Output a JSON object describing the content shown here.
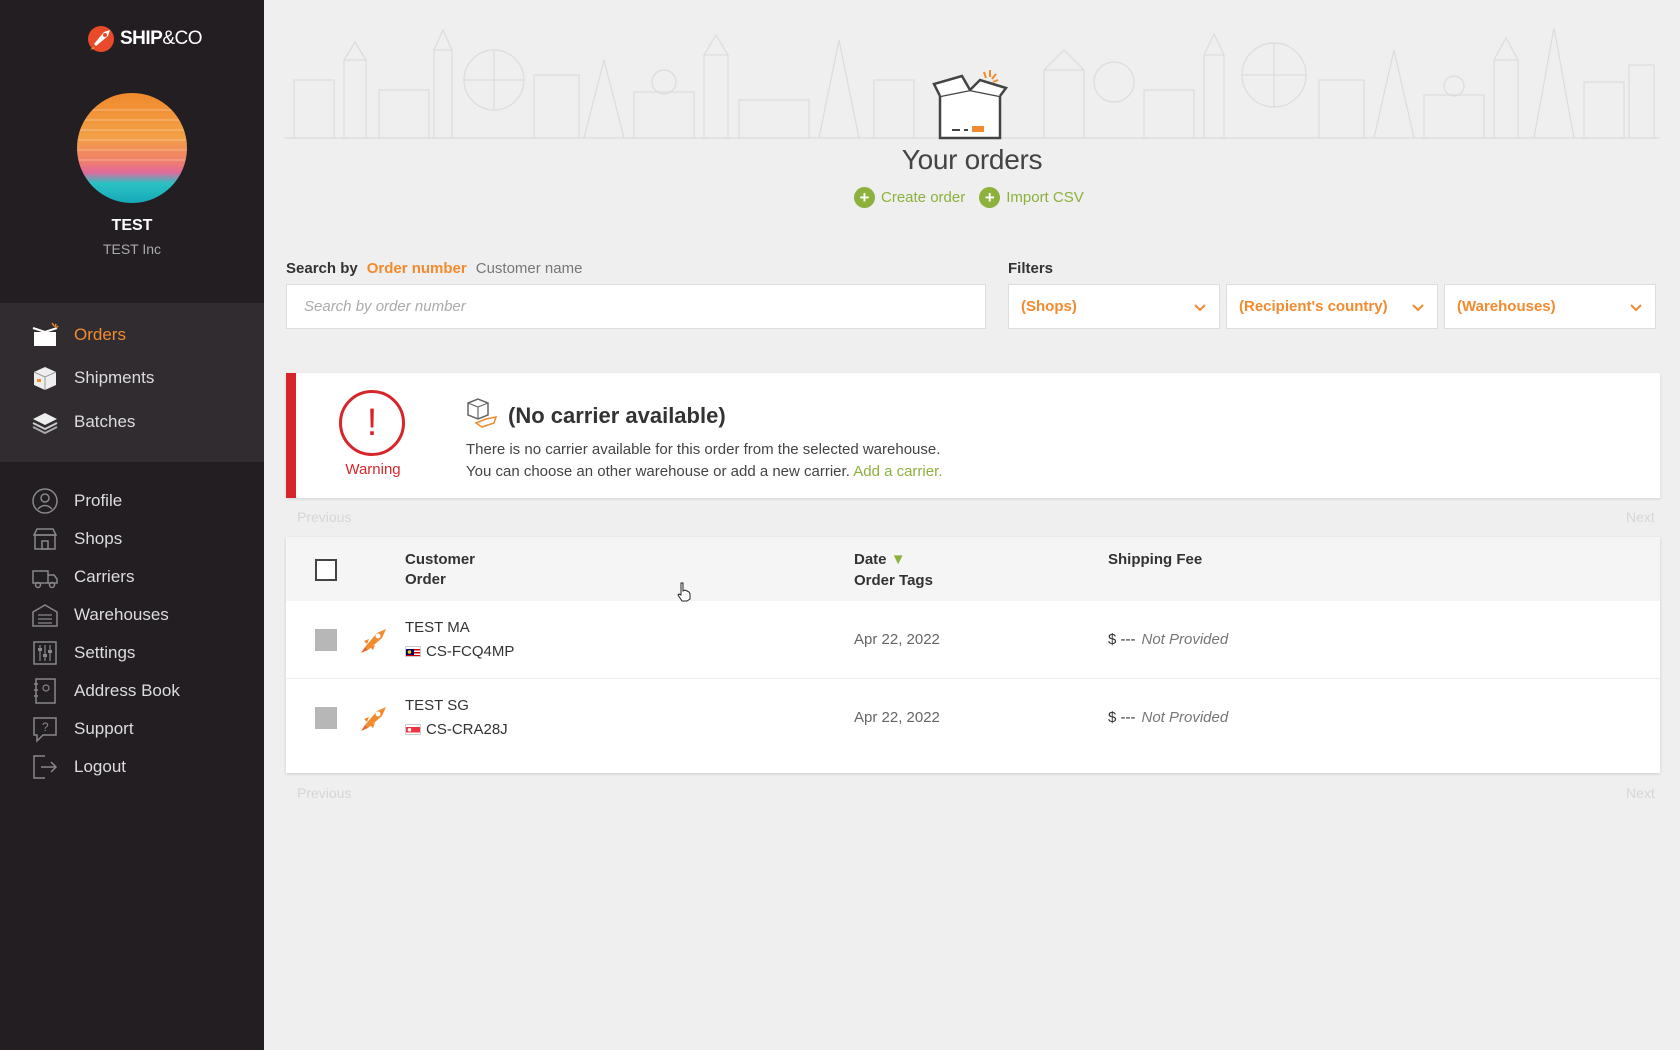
{
  "brand": {
    "name_bold": "SHIP",
    "name_rest": "&CO"
  },
  "user": {
    "name": "TEST",
    "company": "TEST Inc"
  },
  "nav_primary": [
    {
      "label": "Orders",
      "icon": "orders-icon",
      "active": true
    },
    {
      "label": "Shipments",
      "icon": "shipments-icon"
    },
    {
      "label": "Batches",
      "icon": "batches-icon"
    }
  ],
  "nav_secondary": [
    {
      "label": "Profile",
      "icon": "profile-icon"
    },
    {
      "label": "Shops",
      "icon": "shops-icon"
    },
    {
      "label": "Carriers",
      "icon": "carriers-icon"
    },
    {
      "label": "Warehouses",
      "icon": "warehouses-icon"
    },
    {
      "label": "Settings",
      "icon": "settings-icon"
    },
    {
      "label": "Address Book",
      "icon": "address-book-icon"
    },
    {
      "label": "Support",
      "icon": "support-icon"
    },
    {
      "label": "Logout",
      "icon": "logout-icon"
    }
  ],
  "header": {
    "title": "Your orders",
    "create_order": "Create order",
    "import_csv": "Import CSV"
  },
  "search": {
    "lead": "Search by",
    "option_active": "Order number",
    "option_other": "Customer name",
    "placeholder": "Search by order number",
    "value": ""
  },
  "filters": {
    "label": "Filters",
    "shops": "(Shops)",
    "country": "(Recipient's country)",
    "warehouses": "(Warehouses)"
  },
  "warning": {
    "label": "Warning",
    "symbol": "!",
    "title": "(No carrier available)",
    "line1": "There is no carrier available for this order from the selected warehouse.",
    "line2": "You can choose an other warehouse or add a new carrier.",
    "link": "Add a carrier."
  },
  "pagination": {
    "previous": "Previous",
    "next": "Next"
  },
  "table": {
    "headers": {
      "customer": "Customer",
      "order": "Order",
      "date": "Date",
      "sort_indicator": "▼",
      "order_tags": "Order Tags",
      "shipping_fee": "Shipping Fee"
    },
    "rows": [
      {
        "customer": "TEST MA",
        "order": "CS-FCQ4MP",
        "flag": "MY",
        "date": "Apr 22, 2022",
        "fee": "$ ---",
        "fee_note": "Not Provided"
      },
      {
        "customer": "TEST SG",
        "order": "CS-CRA28J",
        "flag": "SG",
        "date": "Apr 22, 2022",
        "fee": "$ ---",
        "fee_note": "Not Provided"
      }
    ]
  },
  "colors": {
    "accent_orange": "#f28a2e",
    "accent_green": "#8cb13c",
    "warning_red": "#d7262b",
    "sidebar_bg": "#221e22"
  }
}
